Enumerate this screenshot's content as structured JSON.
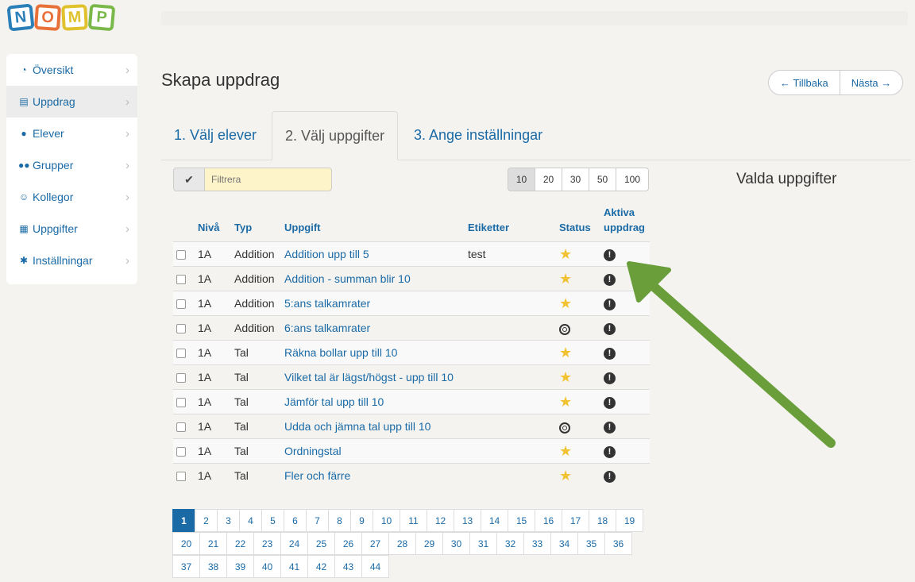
{
  "logo": [
    "N",
    "O",
    "M",
    "P"
  ],
  "sidebar": {
    "items": [
      {
        "label": "Översikt",
        "icon": "dashboard-icon",
        "glyph": "◔"
      },
      {
        "label": "Uppdrag",
        "icon": "book-icon",
        "glyph": "▤"
      },
      {
        "label": "Elever",
        "icon": "user-icon",
        "glyph": "●"
      },
      {
        "label": "Grupper",
        "icon": "users-icon",
        "glyph": "●●"
      },
      {
        "label": "Kollegor",
        "icon": "smiley-icon",
        "glyph": "☺"
      },
      {
        "label": "Uppgifter",
        "icon": "grid-icon",
        "glyph": "▦"
      },
      {
        "label": "Inställningar",
        "icon": "gear-icon",
        "glyph": "✱"
      }
    ],
    "active_index": 1
  },
  "header": {
    "title": "Skapa uppdrag",
    "back_label": "← Tillbaka",
    "next_label": "Nästa →"
  },
  "tabs": [
    {
      "label": "1. Välj elever"
    },
    {
      "label": "2. Välj uppgifter"
    },
    {
      "label": "3. Ange inställningar"
    }
  ],
  "filter": {
    "placeholder": "Filtrera"
  },
  "page_sizes": [
    "10",
    "20",
    "30",
    "50",
    "100"
  ],
  "page_size_selected": "10",
  "selected_panel": {
    "title": "Valda uppgifter"
  },
  "table": {
    "headers": {
      "level": "Nivå",
      "type": "Typ",
      "task": "Uppgift",
      "tags": "Etiketter",
      "status": "Status",
      "active_line1": "Aktiva",
      "active_line2": "uppdrag"
    },
    "rows": [
      {
        "level": "1A",
        "type": "Addition",
        "task": "Addition upp till 5",
        "tags": "test",
        "status": "star"
      },
      {
        "level": "1A",
        "type": "Addition",
        "task": "Addition - summan blir 10",
        "tags": "",
        "status": "star"
      },
      {
        "level": "1A",
        "type": "Addition",
        "task": "5:ans talkamrater",
        "tags": "",
        "status": "star"
      },
      {
        "level": "1A",
        "type": "Addition",
        "task": "6:ans talkamrater",
        "tags": "",
        "status": "target"
      },
      {
        "level": "1A",
        "type": "Tal",
        "task": "Räkna bollar upp till 10",
        "tags": "",
        "status": "star"
      },
      {
        "level": "1A",
        "type": "Tal",
        "task": "Vilket tal är lägst/högst - upp till 10",
        "tags": "",
        "status": "star"
      },
      {
        "level": "1A",
        "type": "Tal",
        "task": "Jämför tal upp till 10",
        "tags": "",
        "status": "star"
      },
      {
        "level": "1A",
        "type": "Tal",
        "task": "Udda och jämna tal upp till 10",
        "tags": "",
        "status": "target"
      },
      {
        "level": "1A",
        "type": "Tal",
        "task": "Ordningstal",
        "tags": "",
        "status": "star"
      },
      {
        "level": "1A",
        "type": "Tal",
        "task": "Fler och färre",
        "tags": "",
        "status": "star"
      }
    ]
  },
  "pagination": {
    "current": "1",
    "rows": [
      [
        "1",
        "2",
        "3",
        "4",
        "5",
        "6",
        "7",
        "8",
        "9",
        "10",
        "11",
        "12",
        "13",
        "14",
        "15",
        "16",
        "17",
        "18",
        "19"
      ],
      [
        "20",
        "21",
        "22",
        "23",
        "24",
        "25",
        "26",
        "27",
        "28",
        "29",
        "30",
        "31",
        "32",
        "33",
        "34",
        "35",
        "36"
      ],
      [
        "37",
        "38",
        "39",
        "40",
        "41",
        "42",
        "43",
        "44"
      ]
    ]
  },
  "colors": {
    "accent": "#1a6aa6",
    "arrow": "#6a9e3a",
    "star": "#f1c232"
  }
}
